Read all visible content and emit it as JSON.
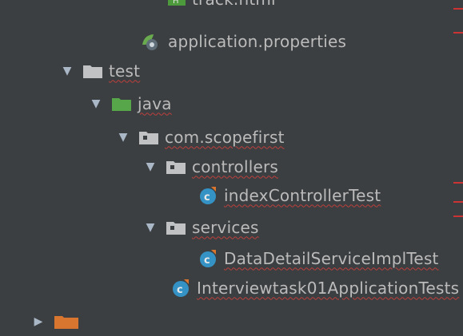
{
  "tree": {
    "items": [
      {
        "label": "track.html",
        "icon": "html-file-icon"
      },
      {
        "label": "application.properties",
        "icon": "properties-file-icon"
      },
      {
        "label": "test",
        "icon": "folder-icon"
      },
      {
        "label": "java",
        "icon": "test-source-folder-icon"
      },
      {
        "label": "com.scopefirst",
        "icon": "package-icon"
      },
      {
        "label": "controllers",
        "icon": "package-icon"
      },
      {
        "label": "indexControllerTest",
        "icon": "test-class-icon"
      },
      {
        "label": "services",
        "icon": "package-icon"
      },
      {
        "label": "DataDetailServiceImplTest",
        "icon": "test-class-icon"
      },
      {
        "label": "Interviewtask01ApplicationTests",
        "icon": "test-class-icon"
      }
    ]
  },
  "colors": {
    "background": "#3c3f41",
    "text": "#bbbbbb",
    "error_underline": "#bc3f3c",
    "error_marker": "#cc3333",
    "folder": "#c0c2c4",
    "test_folder": "#57a64a",
    "class_icon": "#3592c4",
    "target_folder": "#d8762f"
  }
}
